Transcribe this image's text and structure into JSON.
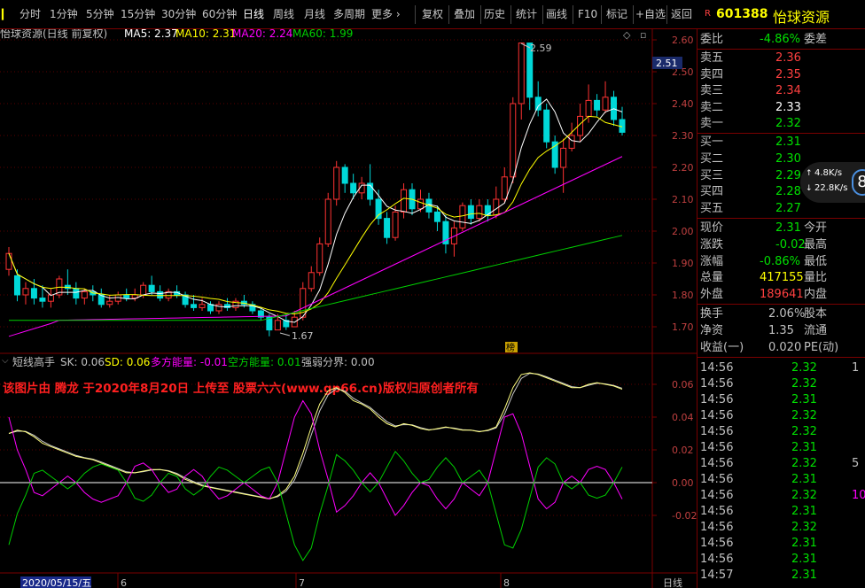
{
  "toolbar": {
    "periods": [
      "分时",
      "1分钟",
      "5分钟",
      "15分钟",
      "30分钟",
      "60分钟",
      "日线",
      "周线",
      "月线",
      "多周期",
      "更多 ›"
    ],
    "active_period": "日线",
    "actions": [
      "复权",
      "叠加",
      "历史",
      "统计",
      "画线",
      "F10",
      "标记",
      "+自选",
      "返回"
    ],
    "collapse_icon": "collapse-icon"
  },
  "stock": {
    "badge": "R",
    "code": "601388",
    "name": "怡球资源"
  },
  "price_chart": {
    "title": "怡球资源(日线 前复权)",
    "ma5_label": "MA5: 2.37",
    "ma10_label": "MA10: 2.31",
    "ma20_label": "MA20: 2.24",
    "ma60_label": "MA60: 1.99",
    "high_label": "2.59",
    "low_label": "1.67",
    "current_price_tag": "2.51",
    "y_ticks": [
      "2.60",
      "2.50",
      "2.40",
      "2.30",
      "2.20",
      "2.10",
      "2.00",
      "1.90",
      "1.80",
      "1.70"
    ],
    "y_values": [
      2.6,
      2.5,
      2.4,
      2.3,
      2.2,
      2.1,
      2.0,
      1.9,
      1.8,
      1.7
    ],
    "marker_label": "榜",
    "colors": {
      "up": "#ff3232",
      "down": "#00d8d8",
      "ma5": "#ffffff",
      "ma10": "#ffff00",
      "ma20": "#ff00ff",
      "ma60": "#00d000"
    }
  },
  "indicator": {
    "name": "短线高手",
    "sk_label": "SK: 0.06",
    "sd_label": "SD: 0.06",
    "long_label": "多方能量: -0.01",
    "short_label": "空方能量: 0.01",
    "strong_label": "强弱分界: 0.00",
    "watermark": "该图片由 腾龙 于2020年8月20日 上传至 股票六六(www.gp66.cn)版权归原创者所有",
    "y_ticks": [
      "0.06",
      "0.04",
      "0.02",
      "0.00",
      "-0.02"
    ],
    "y_values": [
      0.06,
      0.04,
      0.02,
      0.0,
      -0.02
    ]
  },
  "x_axis": {
    "date_label": "2020/05/15/五",
    "months": [
      "6",
      "7",
      "8"
    ],
    "period_label": "日线"
  },
  "quote_panel": {
    "ratio_label": "委比",
    "ratio_value": "-4.86%",
    "diff_label": "委差",
    "asks": [
      {
        "label": "卖五",
        "price": "2.36"
      },
      {
        "label": "卖四",
        "price": "2.35"
      },
      {
        "label": "卖三",
        "price": "2.34"
      },
      {
        "label": "卖二",
        "price": "2.33"
      },
      {
        "label": "卖一",
        "price": "2.32"
      }
    ],
    "bids": [
      {
        "label": "买一",
        "price": "2.31"
      },
      {
        "label": "买二",
        "price": "2.30"
      },
      {
        "label": "买三",
        "price": "2.29"
      },
      {
        "label": "买四",
        "price": "2.28"
      },
      {
        "label": "买五",
        "price": "2.27"
      }
    ],
    "speed_up": "4.8K/s",
    "speed_down": "22.8K/s",
    "speed_badge": "8",
    "stats": [
      {
        "l1": "现价",
        "v1": "2.31",
        "l2": "今开"
      },
      {
        "l1": "涨跌",
        "v1": "-0.02",
        "l2": "最高"
      },
      {
        "l1": "涨幅",
        "v1": "-0.86%",
        "l2": "最低"
      },
      {
        "l1": "总量",
        "v1": "417155",
        "l2": "量比"
      },
      {
        "l1": "外盘",
        "v1": "189641",
        "l2": "内盘"
      }
    ],
    "stats2": [
      {
        "l1": "换手",
        "v1": "2.06%",
        "l2": "股本"
      },
      {
        "l1": "净资",
        "v1": "1.35",
        "l2": "流通"
      },
      {
        "l1": "收益(一)",
        "v1": "0.020",
        "l2": "PE(动)"
      }
    ],
    "ticks": [
      {
        "time": "14:56",
        "price": "2.32",
        "vol": "1"
      },
      {
        "time": "14:56",
        "price": "2.32",
        "vol": ""
      },
      {
        "time": "14:56",
        "price": "2.31",
        "vol": ""
      },
      {
        "time": "14:56",
        "price": "2.32",
        "vol": ""
      },
      {
        "time": "14:56",
        "price": "2.32",
        "vol": ""
      },
      {
        "time": "14:56",
        "price": "2.31",
        "vol": ""
      },
      {
        "time": "14:56",
        "price": "2.32",
        "vol": "5"
      },
      {
        "time": "14:56",
        "price": "2.31",
        "vol": ""
      },
      {
        "time": "14:56",
        "price": "2.32",
        "vol": "10"
      },
      {
        "time": "14:56",
        "price": "2.31",
        "vol": ""
      },
      {
        "time": "14:56",
        "price": "2.32",
        "vol": ""
      },
      {
        "time": "14:56",
        "price": "2.31",
        "vol": ""
      },
      {
        "time": "14:56",
        "price": "2.31",
        "vol": ""
      },
      {
        "time": "14:57",
        "price": "2.31",
        "vol": ""
      }
    ]
  }
}
